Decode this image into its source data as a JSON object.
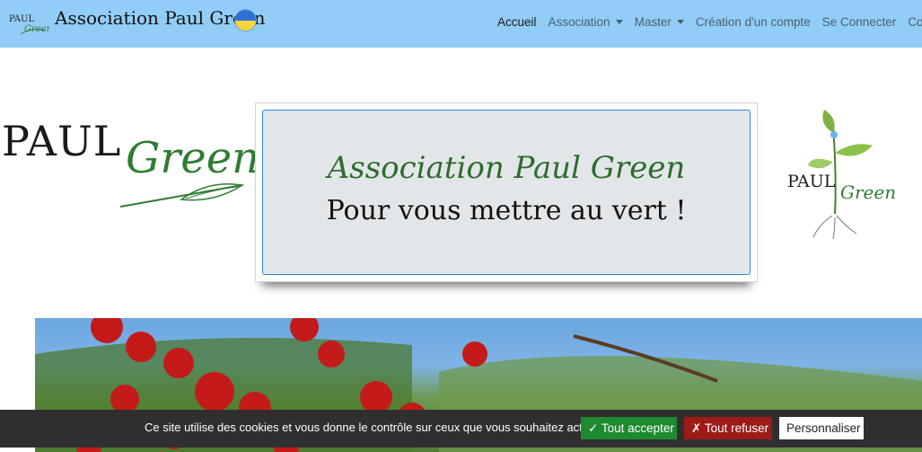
{
  "navbar": {
    "brand_logo_paul": "PAUL",
    "brand_logo_green": "Green",
    "brand_title": "Association Paul Green",
    "flag_icon": "ukraine-flag-icon",
    "items": [
      {
        "label": "Accueil",
        "active": true,
        "dropdown": false
      },
      {
        "label": "Association",
        "active": false,
        "dropdown": true
      },
      {
        "label": "Master",
        "active": false,
        "dropdown": true
      },
      {
        "label": "Création d'un compte",
        "active": false,
        "dropdown": false
      },
      {
        "label": "Se Connecter",
        "active": false,
        "dropdown": false
      },
      {
        "label": "Contact",
        "active": false,
        "dropdown": false
      }
    ]
  },
  "hero": {
    "left_logo": {
      "paul": "PAUL",
      "green": "Green"
    },
    "card_title": "Association Paul Green",
    "card_subtitle": "Pour vous mettre au vert !",
    "right_logo": {
      "paul": "PAUL",
      "green": "Green"
    }
  },
  "cookie_bar": {
    "message": "Ce site utilise des cookies et vous donne le contrôle sur ceux que vous souhaitez activer",
    "accept_label": "✓ Tout accepter",
    "refuse_label": "✗ Tout refuser",
    "customize_label": "Personnaliser"
  },
  "colors": {
    "navbar_bg": "#92cdf8",
    "card_bg": "#e3e6e9",
    "brand_green": "#2e6b2c",
    "accept_green": "#1e8a2f",
    "refuse_red": "#9c1b17",
    "cookie_bg": "#2f2f2f"
  }
}
